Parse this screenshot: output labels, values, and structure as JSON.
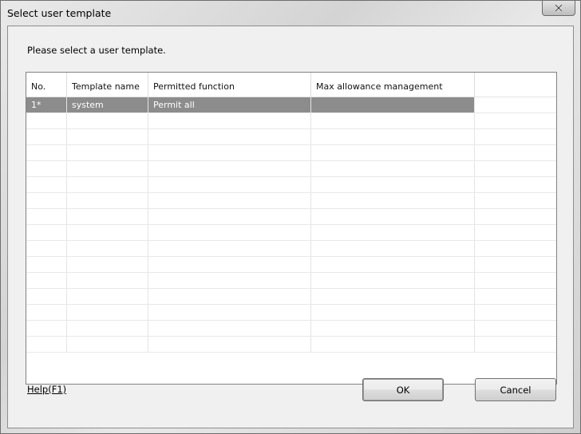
{
  "window": {
    "title": "Select user template",
    "close_label": "X"
  },
  "instruction": "Please select a user template.",
  "grid": {
    "columns": [
      "No.",
      "Template name",
      "Permitted function",
      "Max allowance management",
      ""
    ],
    "rows": [
      {
        "no": "1*",
        "template_name": "system",
        "permitted_function": "Permit all",
        "max_allowance": "",
        "extra": "",
        "selected": true
      }
    ],
    "empty_rows": 15
  },
  "footer": {
    "help_label": "Help(F1)",
    "ok_label": "OK",
    "cancel_label": "Cancel"
  },
  "colors": {
    "selection": "#8c8c8c",
    "client_bg": "#f0f0f0"
  }
}
